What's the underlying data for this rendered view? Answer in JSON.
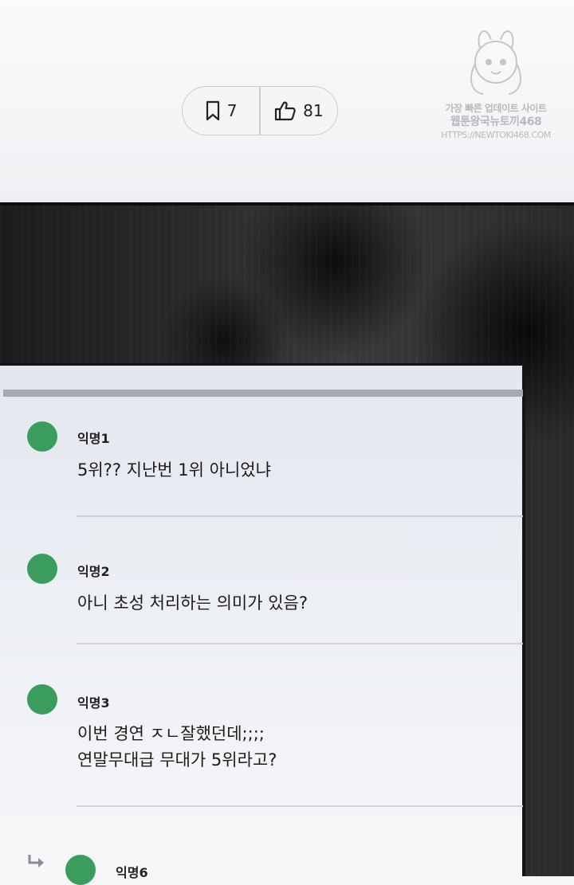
{
  "reactions": {
    "bookmark": {
      "icon": "bookmark-icon",
      "count": "7"
    },
    "like": {
      "icon": "thumbs-up-icon",
      "count": "81"
    }
  },
  "watermark": {
    "line1": "가장 빠른 업데이트 사이트",
    "line2": "웹툰왕국뉴토끼468",
    "line3": "HTTPS://NEWTOKI468.COM"
  },
  "comments": [
    {
      "author": "익명1",
      "text": "5위?? 지난번 1위 아니었냐",
      "avatar_color": "#3a9d5d"
    },
    {
      "author": "익명2",
      "text": "아니 초성 처리하는 의미가 있음?",
      "avatar_color": "#3a9d5d"
    },
    {
      "author": "익명3",
      "text": "이번 경연 ㅈㄴ잘했던데;;;;\n연말무대급 무대가 5위라고?",
      "avatar_color": "#3a9d5d"
    },
    {
      "author": "익명6",
      "text": "",
      "avatar_color": "#3a9d5d",
      "is_reply": true
    }
  ],
  "colors": {
    "avatar": "#3a9d5d",
    "panel_border": "#141414",
    "pill_border": "#c9cdd2"
  }
}
